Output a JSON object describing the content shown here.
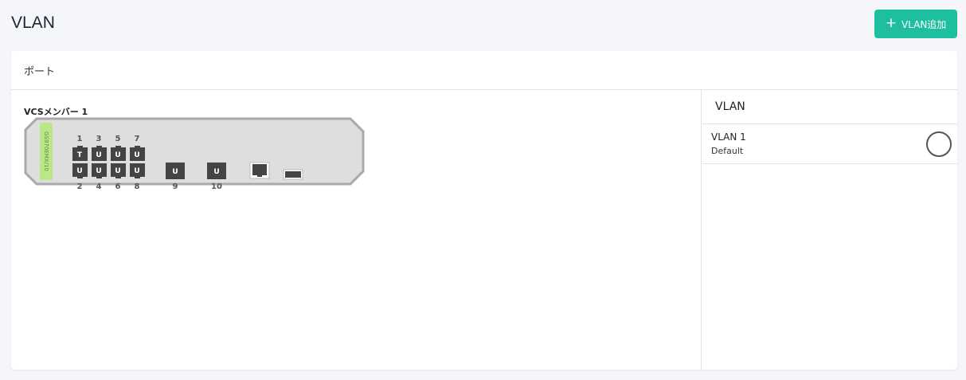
{
  "page": {
    "title": "VLAN"
  },
  "toolbar": {
    "add_label": "VLAN追加",
    "add_icon": "plus-icon"
  },
  "ports_card": {
    "title": "ポート",
    "member_label": "VCSメンバー 1",
    "model": "GS970EMX/10",
    "ports": [
      {
        "num": "1",
        "tag": "T"
      },
      {
        "num": "2",
        "tag": "U"
      },
      {
        "num": "3",
        "tag": "U"
      },
      {
        "num": "4",
        "tag": "U"
      },
      {
        "num": "5",
        "tag": "U"
      },
      {
        "num": "6",
        "tag": "U"
      },
      {
        "num": "7",
        "tag": "U"
      },
      {
        "num": "8",
        "tag": "U"
      },
      {
        "num": "9",
        "tag": "U"
      },
      {
        "num": "10",
        "tag": "U"
      }
    ]
  },
  "vlan_panel": {
    "title": "VLAN",
    "items": [
      {
        "name": "VLAN 1",
        "description": "Default"
      }
    ]
  },
  "colors": {
    "accent": "#1dbf9f",
    "port": "#444444",
    "model_badge": "#b8e986"
  }
}
